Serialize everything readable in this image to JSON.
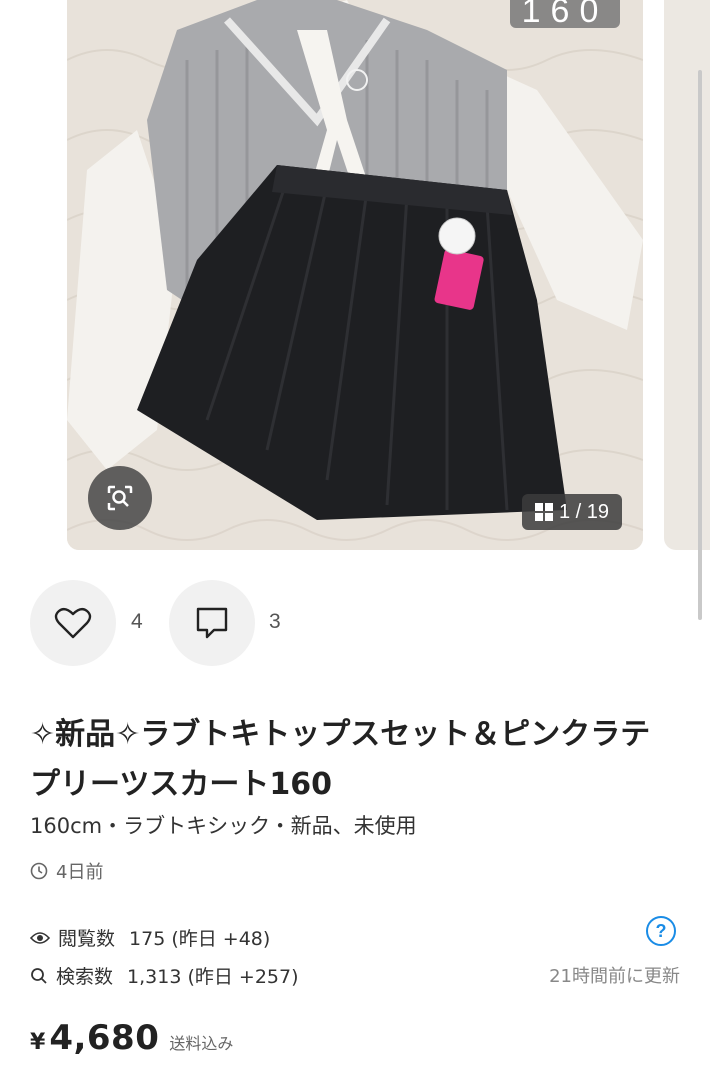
{
  "gallery": {
    "size_overlay": "160",
    "counter": "1 / 19",
    "zoom_icon": "zoom-search-icon",
    "counter_icon": "grid-icon"
  },
  "actions": {
    "like_icon": "heart-icon",
    "like_count": "4",
    "comment_icon": "comment-icon",
    "comment_count": "3"
  },
  "item": {
    "title": "✧新品✧ラブトキトップスセット＆ピンクラテプリーツスカート160",
    "meta": "160cm・ラブトキシック・新品、未使用",
    "posted": "4日前"
  },
  "stats": {
    "views_label": "閲覧数",
    "views_value": "175 (昨日 +48)",
    "search_label": "検索数",
    "search_value": "1,313 (昨日 +257)",
    "updated": "21時間前に更新",
    "help": "?"
  },
  "price": {
    "currency": "¥",
    "amount": "4,680",
    "shipping": "送料込み"
  },
  "colors": {
    "accent": "#1a8ce6",
    "text": "#222222",
    "muted": "#888888"
  }
}
